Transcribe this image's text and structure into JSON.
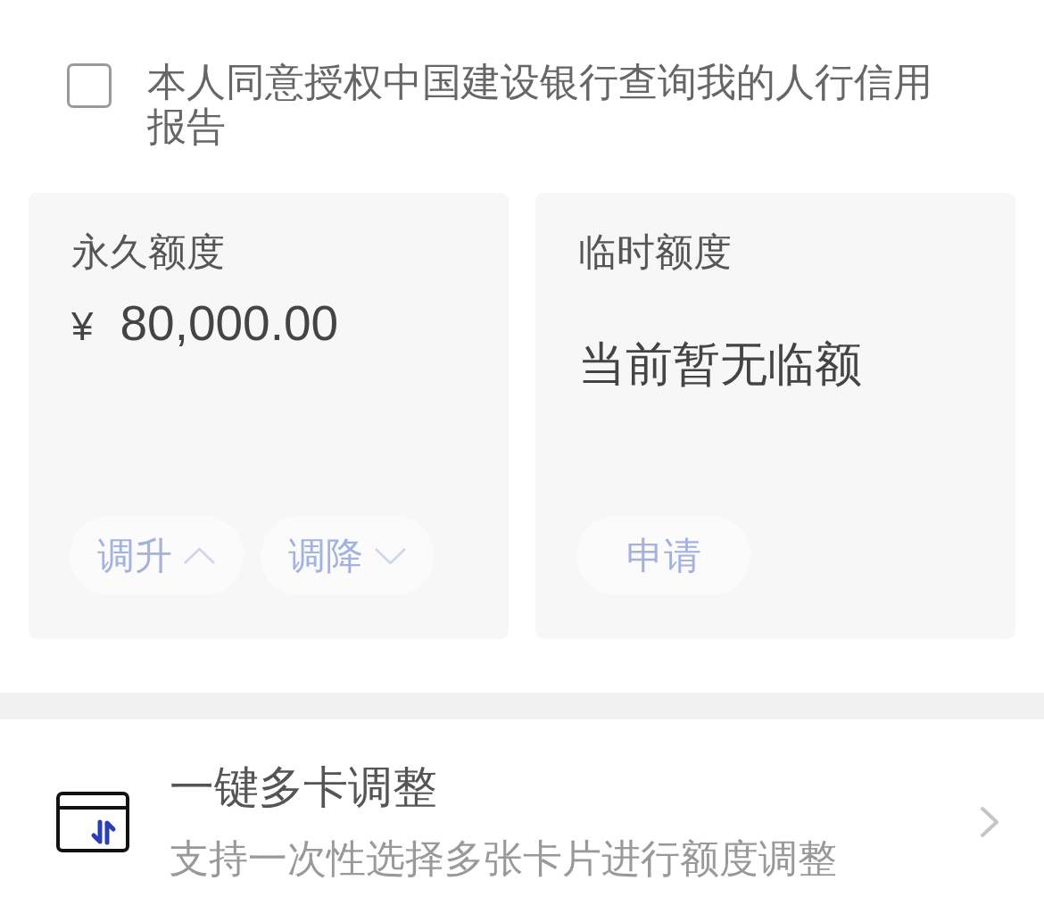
{
  "consent": {
    "checked": false,
    "text": "本人同意授权中国建设银行查询我的人行信用报告"
  },
  "limit_cards": [
    {
      "title": "永久额度",
      "kind": "amount",
      "currency": "¥",
      "amount": "80,000.00",
      "buttons": [
        {
          "label": "调升",
          "kind": "increase"
        },
        {
          "label": "调降",
          "kind": "decrease"
        }
      ]
    },
    {
      "title": "临时额度",
      "kind": "message",
      "message": "当前暂无临额",
      "buttons": [
        {
          "label": "申请",
          "kind": "apply"
        }
      ]
    }
  ],
  "list_items": [
    {
      "title": "一键多卡调整",
      "subtitle": "支持一次性选择多张卡片进行额度调整"
    }
  ]
}
